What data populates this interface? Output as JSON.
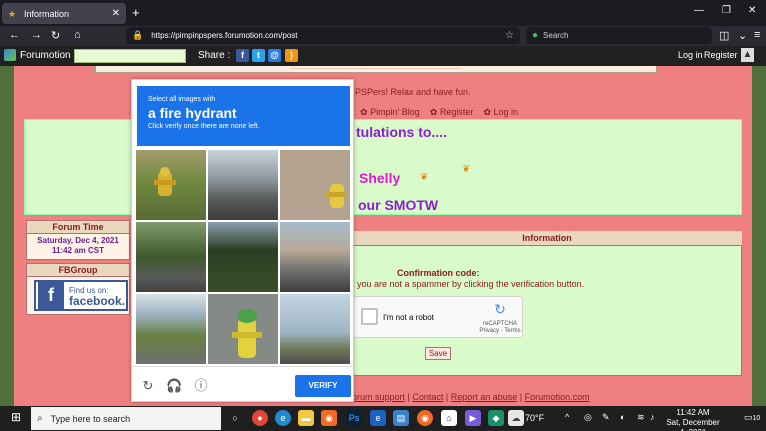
{
  "browser": {
    "tab_title": "Information",
    "url": "https://pimpinpspers.forumotion.com/post",
    "search_placeholder": "Search"
  },
  "forumotion_bar": {
    "brand": "Forumotion",
    "share_label": "Share :",
    "login": "Log in",
    "register": "Register"
  },
  "page": {
    "welcome_partial": "PSPers! Relax and have fun.",
    "nav": [
      "Pimpin' Blog",
      "Register",
      "Log in"
    ],
    "congrats_partial": "tulations to....",
    "winner": "Shelly",
    "smotw_partial": "our SMOTW",
    "forum_time": {
      "title": "Forum Time",
      "date": "Saturday, Dec 4, 2021",
      "time": "11:42 am CST"
    },
    "fbgroup": {
      "title": "FBGroup",
      "find_us": "Find us on:",
      "facebook": "facebook."
    },
    "information": {
      "title": "Information",
      "confirmation_label": "Confirmation code:",
      "instruction_partial": "t you are not a spammer by clicking the verification button.",
      "recaptcha_label": "I'm not a robot",
      "recaptcha_brand": "reCAPTCHA",
      "recaptcha_terms": "Privacy - Terms",
      "save_button": "Save"
    },
    "footer_links": [
      "orum support",
      "Contact",
      "Report an abuse",
      "Forumotion.com"
    ]
  },
  "captcha": {
    "instruction": "Select all images with",
    "object": "a fire hydrant",
    "sub_instruction": "Click verify once there are none left.",
    "verify_button": "VERIFY",
    "footer_icons": [
      "reload-icon",
      "audio-icon",
      "info-icon"
    ],
    "tiles": [
      "hydrant-yellow",
      "overpass-road",
      "gravel-hydrant",
      "tree-road",
      "power-lines-trees",
      "road-buildings",
      "roadside-grass",
      "hydrant-green-cap",
      "street-sky"
    ]
  },
  "taskbar": {
    "search_placeholder": "Type here to search",
    "weather": "70°F",
    "time": "11:42 AM",
    "date": "Sat, December 4, 2021",
    "notifications": "10"
  },
  "colors": {
    "pink_bg": "#f08080",
    "green_panel": "#d9fbc9",
    "captcha_blue": "#1a73e8",
    "purple_text": "#8a1fd1",
    "magenta_text": "#e11bd7"
  }
}
